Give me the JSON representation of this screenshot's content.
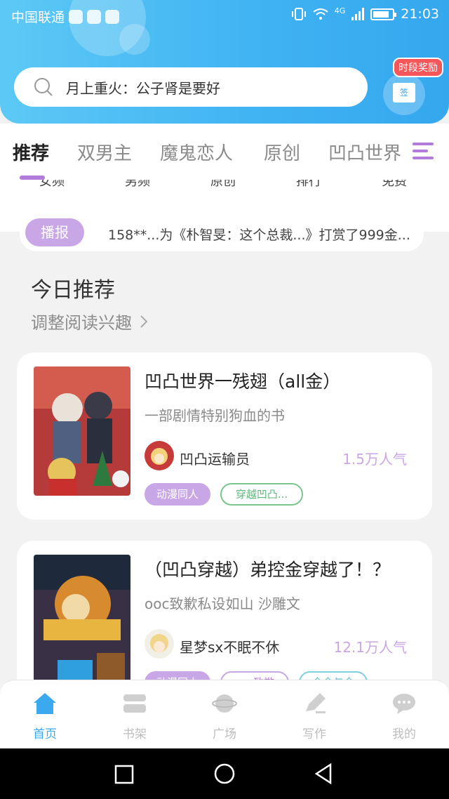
{
  "status_bar": {
    "carrier": "中国联通",
    "network": "4G",
    "time": "21:03"
  },
  "search": {
    "placeholder": "月上重火：公子肾是要好"
  },
  "reward": {
    "badge": "时段奖励",
    "gift_label": "签"
  },
  "tabs": [
    {
      "label": "推荐",
      "active": true
    },
    {
      "label": "双男主",
      "active": false
    },
    {
      "label": "魔鬼恋人",
      "active": false
    },
    {
      "label": "原创",
      "active": false
    },
    {
      "label": "凹凸世界",
      "active": false
    }
  ],
  "subnav": [
    "女频",
    "男频",
    "原创",
    "排行",
    "免费"
  ],
  "broadcast": {
    "badge": "播报",
    "text": "158**...为《朴智旻：这个总裁...》打赏了999金..."
  },
  "section": {
    "title": "今日推荐",
    "adjust": "调整阅读兴趣"
  },
  "books": [
    {
      "title": "凹凸世界一残翅（all金）",
      "desc": "一部剧情特别狗血的书",
      "author": "凹凸运输员",
      "popularity": "1.5万人气",
      "tags": [
        "动漫同人",
        "穿越凹凸..."
      ]
    },
    {
      "title": "（凹凸穿越）弟控金穿越了！？",
      "desc": "ooc致歉私设如山 沙雕文",
      "author": "星梦sx不眠不休",
      "popularity": "12.1万人气",
      "tags": [
        "动漫同人",
        "ooc致歉",
        "金金与金"
      ]
    }
  ],
  "bottom_nav": [
    {
      "label": "首页",
      "icon": "home-icon",
      "active": true
    },
    {
      "label": "书架",
      "icon": "bookshelf-icon",
      "active": false
    },
    {
      "label": "广场",
      "icon": "planet-icon",
      "active": false
    },
    {
      "label": "写作",
      "icon": "pen-icon",
      "active": false
    },
    {
      "label": "我的",
      "icon": "chat-bubble-icon",
      "active": false
    }
  ],
  "colors": {
    "accent": "#3aa9ee",
    "purple": "#b27ad9",
    "tag_green": "#5cb87a"
  }
}
